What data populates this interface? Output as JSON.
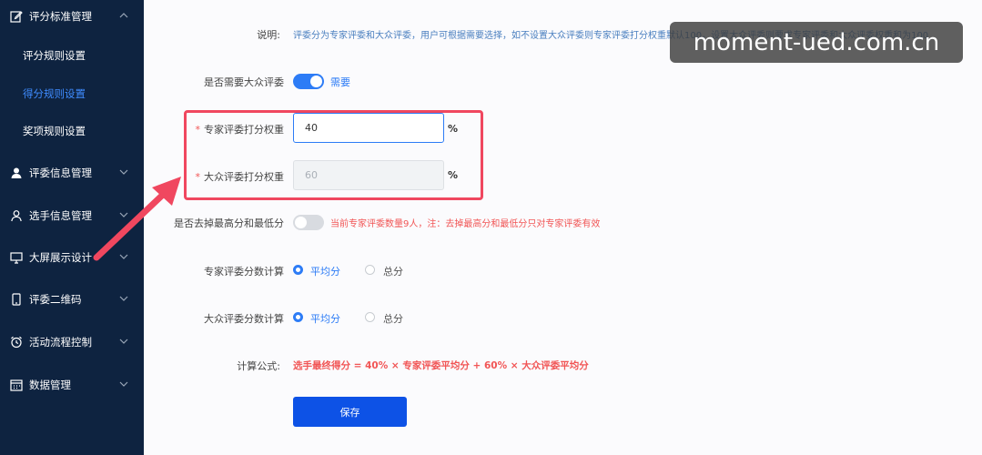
{
  "sidebar": {
    "groups": [
      {
        "label": "评分标准管理",
        "icon": "edit-icon"
      },
      {
        "label": "评委信息管理",
        "icon": "user-filled-icon"
      },
      {
        "label": "选手信息管理",
        "icon": "user-outline-icon"
      },
      {
        "label": "大屏展示设计",
        "icon": "monitor-icon"
      },
      {
        "label": "评委二维码",
        "icon": "mobile-icon"
      },
      {
        "label": "活动流程控制",
        "icon": "alarm-clock-icon"
      },
      {
        "label": "数据管理",
        "icon": "calendar-icon"
      }
    ],
    "sub_items": [
      {
        "label": "评分规则设置"
      },
      {
        "label": "得分规则设置"
      },
      {
        "label": "奖项规则设置"
      }
    ]
  },
  "form": {
    "desc_label": "说明:",
    "desc_text": "评委分为专家评委和大众评委，用户可根据需要选择，如不设置大众评委则专家评委打分权重默认100，设置大众评委则要求专家评委和大众评委权重和为100",
    "need_public_label": "是否需要大众评委",
    "need_public_value": "需要",
    "expert_weight_label": "专家评委打分权重",
    "expert_weight_value": "40",
    "public_weight_label": "大众评委打分权重",
    "public_weight_value": "60",
    "unit": "%",
    "remove_extreme_label": "是否去掉最高分和最低分",
    "remove_extreme_note": "当前专家评委数量9人，注：去掉最高分和最低分只对专家评委有效",
    "expert_calc_label": "专家评委分数计算",
    "public_calc_label": "大众评委分数计算",
    "option_avg": "平均分",
    "option_total": "总分",
    "formula_label": "计算公式:",
    "formula_text": "选手最终得分 = 40% × 专家评委平均分 + 60% × 大众评委平均分",
    "save_label": "保存"
  },
  "watermark": "moment-ued.com.cn",
  "colors": {
    "sidebar_bg": "#0e2340",
    "accent": "#2d7cf6",
    "save_button": "#0d52e6",
    "warning_red": "#f15555",
    "highlight": "#f0475f"
  }
}
